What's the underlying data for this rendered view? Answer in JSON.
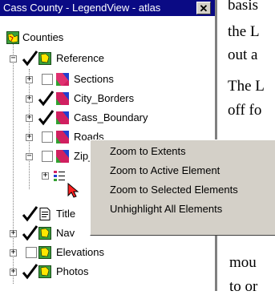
{
  "background_text": {
    "line1": "basis",
    "line2": "the L",
    "line3": "out a",
    "line4": "The L",
    "line5": "off fo",
    "line6": "mou",
    "line7": "to or"
  },
  "window": {
    "title": "Cass County - LegendView - atlas",
    "close_glyph": "✕"
  },
  "tree": {
    "root": "Counties",
    "reference": "Reference",
    "sections": "Sections",
    "city_borders": "City_Borders",
    "cass_boundary": "Cass_Boundary",
    "roads": "Roads",
    "zip_codes": "Zip_Codes",
    "title_partial": "Title",
    "nav_partial": "Nav",
    "elevations": "Elevations",
    "photos": "Photos"
  },
  "context_menu": {
    "items": [
      "Zoom to Extents",
      "Zoom to Active Element",
      "Zoom to Selected Elements",
      "Unhighlight All Elements"
    ]
  },
  "icons": {
    "counties": "map-icon",
    "layer": "layer-icon",
    "check": "checkmark-icon",
    "legend": "legend-icon",
    "cursor": "arrow-cursor-icon",
    "close": "close-icon"
  }
}
